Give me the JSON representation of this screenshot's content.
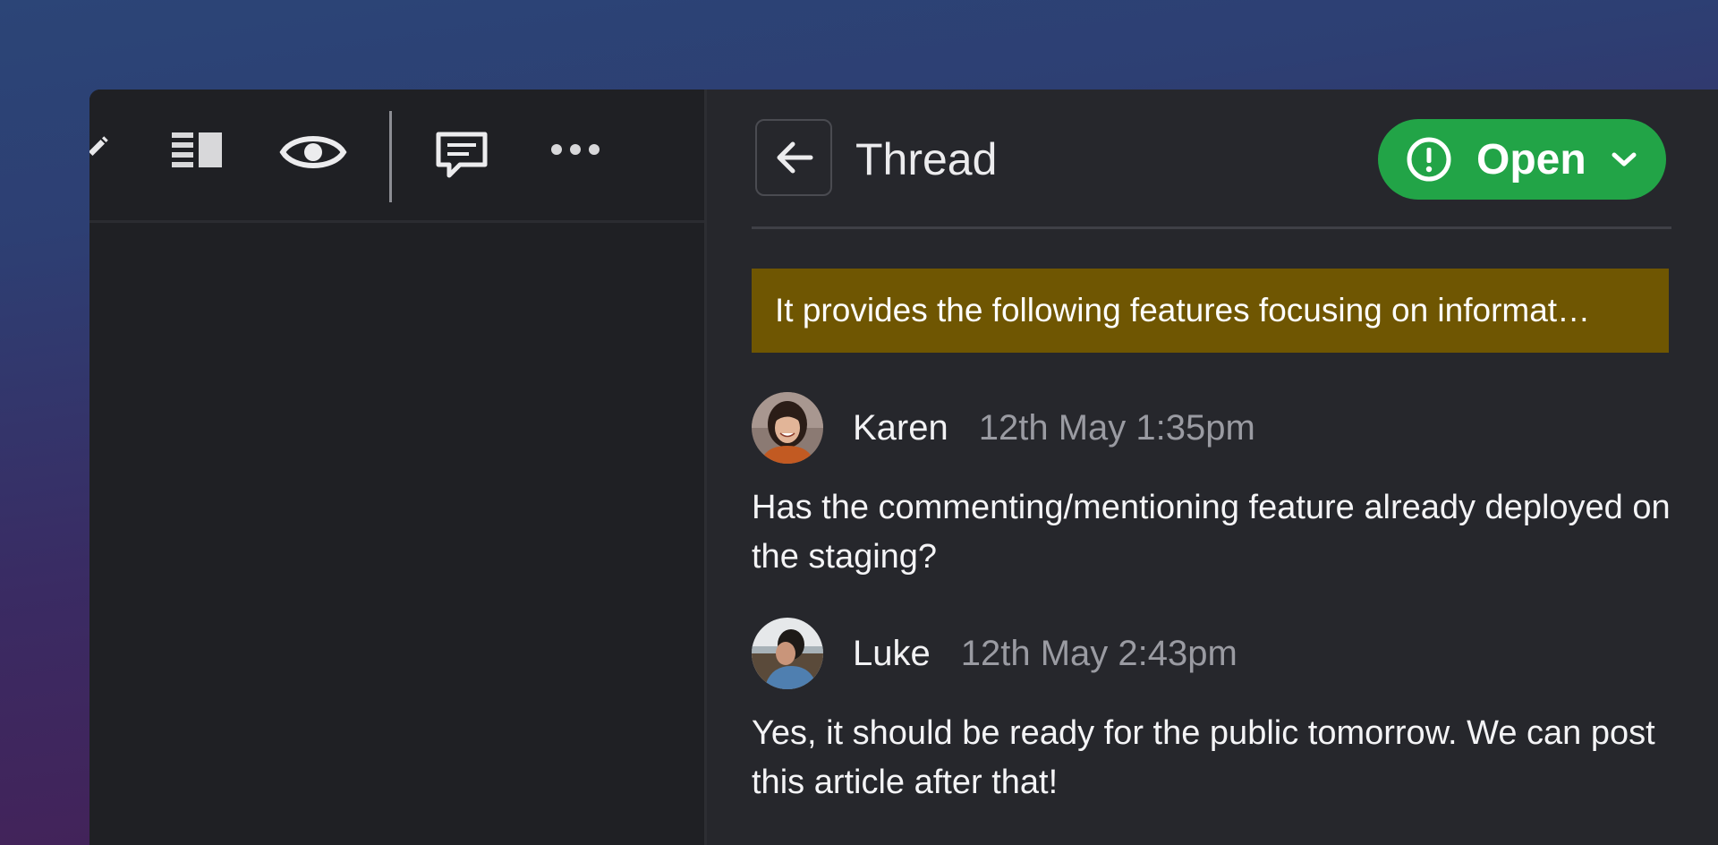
{
  "toolbar": {
    "icons": [
      "pencil-icon",
      "layout-icon",
      "eye-icon",
      "comment-icon",
      "more-icon"
    ]
  },
  "thread": {
    "back_icon": "arrow-left-icon",
    "title": "Thread",
    "status": {
      "label": "Open",
      "icon": "alert-circle-icon",
      "color": "#22a447"
    },
    "highlight": {
      "text": "It provides the following features focusing on informat…",
      "color": "#6f5602"
    },
    "comments": [
      {
        "author": "Karen",
        "time": "12th May 1:35pm",
        "body": "Has the commenting/mentioning feature already deployed on the staging?"
      },
      {
        "author": "Luke",
        "time": "12th May 2:43pm",
        "body": "Yes, it should be ready for the public tomorrow. We can post this article after that!"
      }
    ]
  }
}
